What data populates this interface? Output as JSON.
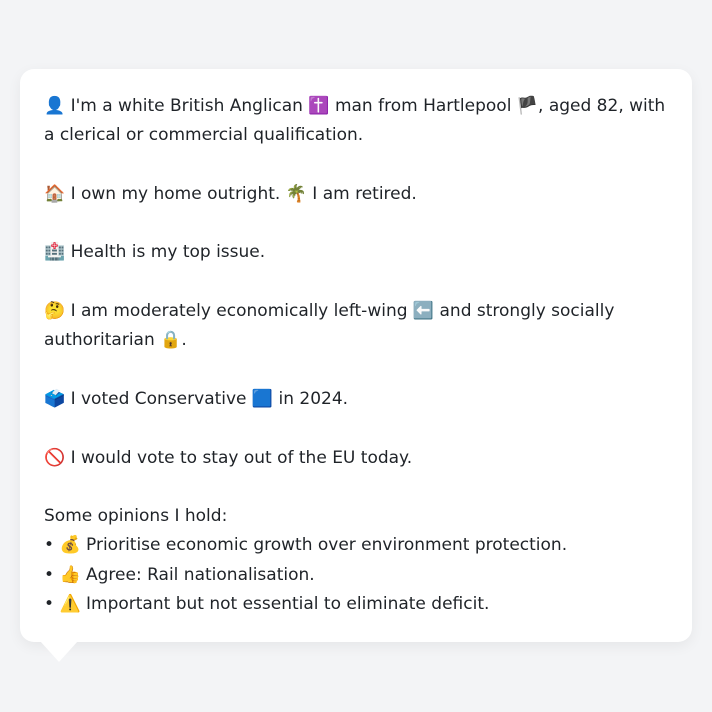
{
  "card": {
    "identity": {
      "icon": "👤",
      "text1": "I'm a white British Anglican",
      "religion_icon": "✝️",
      "text2": "man from Hartlepool",
      "flag_icon": "🏴",
      "text3": ", aged 82, with a clerical or commercial qualification."
    },
    "housing": {
      "home_icon": "🏠",
      "home_text": "I own my home outright.",
      "retired_icon": "🌴",
      "retired_text": "I am retired."
    },
    "issue": {
      "icon": "🏥",
      "text": "Health is my top issue."
    },
    "ideology": {
      "icon": "🤔",
      "text1": "I am moderately economically left-wing",
      "left_icon": "⬅️",
      "text2": "and strongly socially authoritarian",
      "lock_icon": "🔒",
      "text3": "."
    },
    "vote": {
      "icon": "🗳️",
      "text1": "I voted Conservative",
      "party_icon": "🟦",
      "text2": "in 2024."
    },
    "eu": {
      "icon": "🚫",
      "text": "I would vote to stay out of the EU today."
    },
    "opinions": {
      "heading": "Some opinions I hold:",
      "items": [
        {
          "bullet": "•",
          "icon": "💰",
          "text": "Prioritise economic growth over environment protection."
        },
        {
          "bullet": "•",
          "icon": "👍",
          "text": "Agree: Rail nationalisation."
        },
        {
          "bullet": "•",
          "icon": "⚠️",
          "text": "Important but not essential to eliminate deficit."
        }
      ]
    }
  },
  "colors": {
    "background": "#f3f4f6",
    "card": "#ffffff",
    "text": "#1f2328"
  }
}
